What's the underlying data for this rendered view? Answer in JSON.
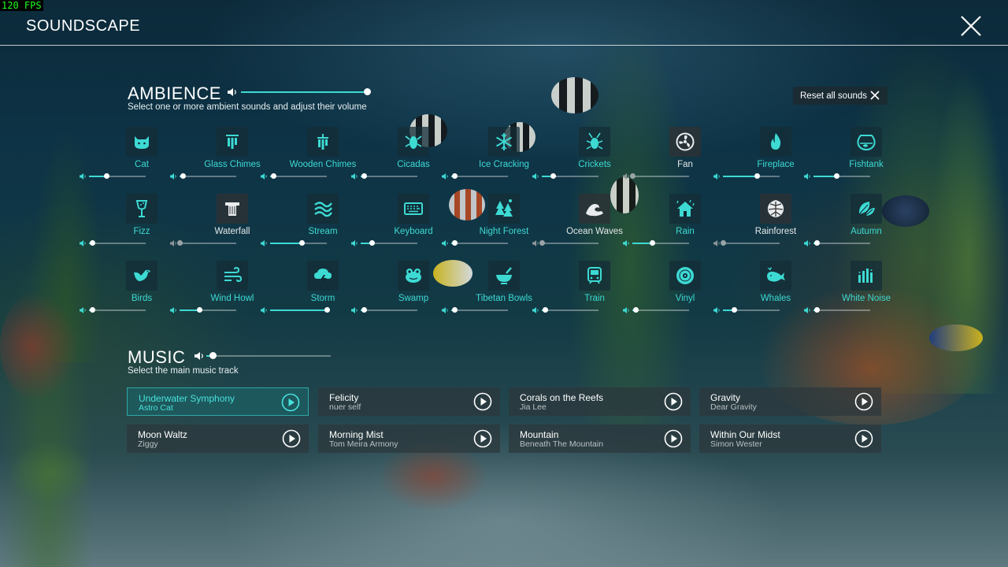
{
  "fps_counter": "120 FPS",
  "app_title": "SOUNDSCAPE",
  "colors": {
    "accent": "#3ddad3",
    "inactive": "#e4e7e8"
  },
  "ambience": {
    "title": "AMBIENCE",
    "subtitle": "Select one or more ambient sounds and adjust their volume",
    "master_volume": 1.0,
    "reset_label": "Reset all sounds",
    "sounds": [
      {
        "label": "Cat",
        "icon": "cat-icon",
        "active": true,
        "volume": 0.3
      },
      {
        "label": "Glass Chimes",
        "icon": "glass-chimes-icon",
        "active": true,
        "volume": 0.05
      },
      {
        "label": "Wooden Chimes",
        "icon": "wooden-chimes-icon",
        "active": true,
        "volume": 0.05
      },
      {
        "label": "Cicadas",
        "icon": "cicada-icon",
        "active": true,
        "volume": 0.05
      },
      {
        "label": "Ice Cracking",
        "icon": "snowflake-icon",
        "active": true,
        "volume": 0.05
      },
      {
        "label": "Crickets",
        "icon": "cricket-icon",
        "active": true,
        "volume": 0.2
      },
      {
        "label": "Fan",
        "icon": "fan-icon",
        "active": false,
        "volume": 0.0
      },
      {
        "label": "Fireplace",
        "icon": "flame-icon",
        "active": true,
        "volume": 0.6
      },
      {
        "label": "Fishtank",
        "icon": "fishbowl-icon",
        "active": true,
        "volume": 0.4
      },
      {
        "label": "Fizz",
        "icon": "wine-glass-icon",
        "active": true,
        "volume": 0.05
      },
      {
        "label": "Waterfall",
        "icon": "waterfall-icon",
        "active": false,
        "volume": 0.0
      },
      {
        "label": "Stream",
        "icon": "stream-icon",
        "active": true,
        "volume": 0.55
      },
      {
        "label": "Keyboard",
        "icon": "keyboard-icon",
        "active": true,
        "volume": 0.2
      },
      {
        "label": "Night Forest",
        "icon": "forest-icon",
        "active": true,
        "volume": 0.05
      },
      {
        "label": "Ocean Waves",
        "icon": "wave-icon",
        "active": false,
        "volume": 0.0
      },
      {
        "label": "Rain",
        "icon": "rain-house-icon",
        "active": true,
        "volume": 0.35
      },
      {
        "label": "Rainforest",
        "icon": "monstera-leaf-icon",
        "active": false,
        "volume": 0.0
      },
      {
        "label": "Autumn",
        "icon": "leaves-icon",
        "active": true,
        "volume": 0.05
      },
      {
        "label": "Birds",
        "icon": "bird-icon",
        "active": true,
        "volume": 0.05
      },
      {
        "label": "Wind Howl",
        "icon": "wind-icon",
        "active": true,
        "volume": 0.35
      },
      {
        "label": "Storm",
        "icon": "storm-cloud-icon",
        "active": true,
        "volume": 1.0
      },
      {
        "label": "Swamp",
        "icon": "frog-icon",
        "active": true,
        "volume": 0.05
      },
      {
        "label": "Tibetan Bowls",
        "icon": "singing-bowl-icon",
        "active": true,
        "volume": 0.05
      },
      {
        "label": "Train",
        "icon": "train-icon",
        "active": true,
        "volume": 0.05
      },
      {
        "label": "Vinyl",
        "icon": "vinyl-icon",
        "active": true,
        "volume": 0.05
      },
      {
        "label": "Whales",
        "icon": "whale-icon",
        "active": true,
        "volume": 0.2
      },
      {
        "label": "White Noise",
        "icon": "bars-icon",
        "active": true,
        "volume": 0.05
      }
    ]
  },
  "music": {
    "title": "MUSIC",
    "subtitle": "Select the main music track",
    "master_volume": 0.05,
    "tracks": [
      {
        "title": "Underwater Symphony",
        "artist": "Astro Cat",
        "active": true
      },
      {
        "title": "Felicity",
        "artist": "nuer self",
        "active": false
      },
      {
        "title": "Corals on the Reefs",
        "artist": "Jia Lee",
        "active": false
      },
      {
        "title": "Gravity",
        "artist": "Dear Gravity",
        "active": false
      },
      {
        "title": "Moon Waltz",
        "artist": "Ziggy",
        "active": false
      },
      {
        "title": "Morning Mist",
        "artist": "Tom Meira Armony",
        "active": false
      },
      {
        "title": "Mountain",
        "artist": "Beneath The Mountain",
        "active": false
      },
      {
        "title": "Within Our Midst",
        "artist": "Simon Wester",
        "active": false
      }
    ]
  }
}
